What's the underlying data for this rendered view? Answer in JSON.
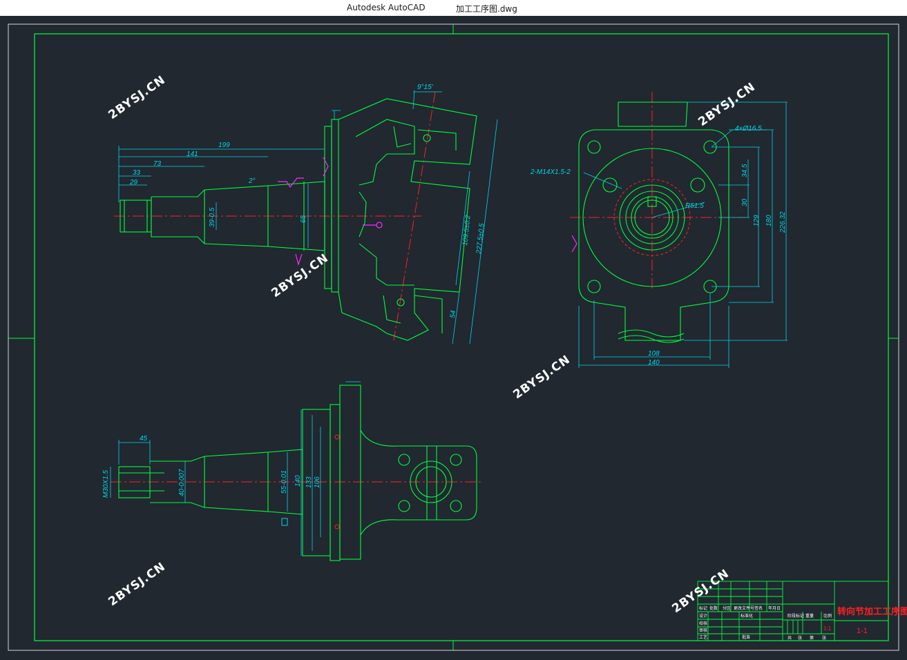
{
  "window": {
    "app_title": "Autodesk AutoCAD",
    "file_name": "加工工序图.dwg"
  },
  "watermark": "2BYSJ.CN",
  "colors": {
    "background": "#212830",
    "geometry": "#00ff3c",
    "dimension": "#00d7e8",
    "centerline": "#ff2020",
    "frame": "#d8d8d8",
    "symbol": "#ff2aff",
    "watermark": "#ffffff"
  },
  "view_front": {
    "dims": [
      "199",
      "141",
      "73",
      "33",
      "29",
      "2°",
      "39-0.5",
      "65",
      "109.5±0.2",
      "227.5±0.5",
      "54",
      "9°15'"
    ]
  },
  "view_side": {
    "dims": [
      "4×Ø16.5",
      "2-M14X1.5-2",
      "R51.5",
      "34.5",
      "30",
      "129",
      "180",
      "226.32",
      "108",
      "140"
    ]
  },
  "view_bottom": {
    "dims": [
      "45",
      "M30X1.5",
      "40-0.007",
      "55-0.01",
      "140",
      "133",
      "106"
    ]
  },
  "title_block": {
    "part_title": "转向节加工工序图",
    "scale": "1:1",
    "sheet": "1-1",
    "row_labels": [
      "标记",
      "设计",
      "校核",
      "审核",
      "工艺"
    ],
    "header_cells": [
      "处数",
      "分区",
      "更改文件号",
      "签名",
      "年月日"
    ],
    "mid_labels": [
      "标准化",
      "批准"
    ],
    "stage_label": "阶段标记",
    "weight_label": "重量",
    "ratio_label": "比例",
    "sheet_labels": [
      "共",
      "张",
      "第",
      "张"
    ]
  }
}
